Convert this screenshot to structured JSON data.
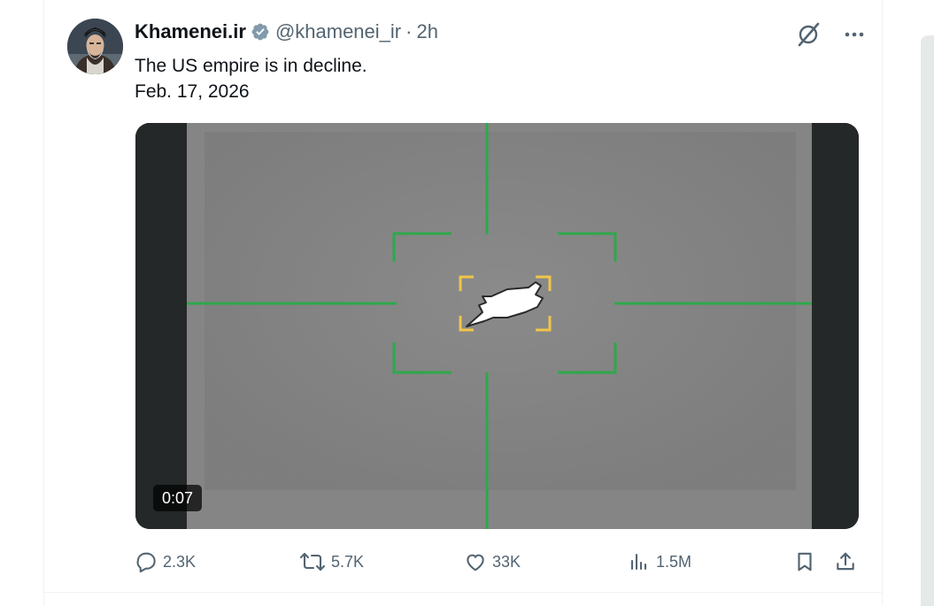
{
  "tweet": {
    "display_name": "Khamenei.ir",
    "handle": "@khamenei_ir",
    "separator": "·",
    "time": "2h",
    "text_line1": "The US empire is in decline.",
    "text_line2": "Feb. 17, 2026",
    "verified": true
  },
  "media": {
    "type": "video",
    "duration": "0:07",
    "reticle_color": "#2ea84a",
    "target_box_color": "#f0c54a"
  },
  "actions": {
    "replies": "2.3K",
    "reposts": "5.7K",
    "likes": "33K",
    "views": "1.5M"
  },
  "icons": {
    "grok": "grok-icon",
    "more": "more-icon",
    "reply": "reply-icon",
    "repost": "repost-icon",
    "like": "like-icon",
    "views": "views-icon",
    "bookmark": "bookmark-icon",
    "share": "share-icon"
  },
  "colors": {
    "text_primary": "#0f1419",
    "text_secondary": "#536471",
    "verified": "#829aab"
  }
}
